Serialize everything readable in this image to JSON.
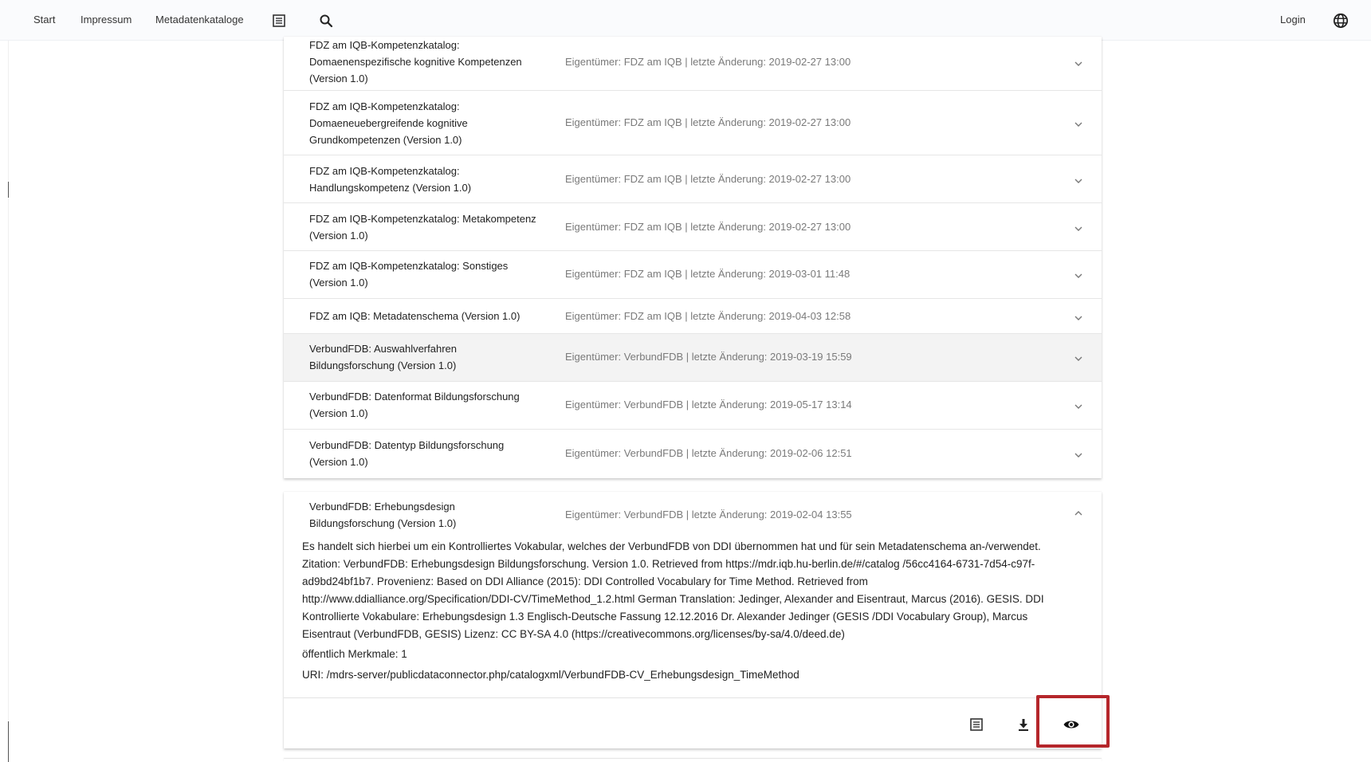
{
  "nav": {
    "start": "Start",
    "impressum": "Impressum",
    "metadatenkataloge": "Metadatenkataloge",
    "login": "Login",
    "icons": [
      "list-icon",
      "search-icon",
      "globe-icon"
    ]
  },
  "catalogs": [
    {
      "title": "FDZ am IQB-Kompetenzkatalog: Domaenenspezifische kognitive Kompetenzen (Version 1.0)",
      "meta": "Eigentümer: FDZ am IQB | letzte Änderung: 2019-02-27 13:00"
    },
    {
      "title": "FDZ am IQB-Kompetenzkatalog: Domaeneuebergreifende kognitive Grundkompetenzen (Version 1.0)",
      "meta": "Eigentümer: FDZ am IQB | letzte Änderung: 2019-02-27 13:00"
    },
    {
      "title": "FDZ am IQB-Kompetenzkatalog: Handlungskompetenz (Version 1.0)",
      "meta": "Eigentümer: FDZ am IQB | letzte Änderung: 2019-02-27 13:00"
    },
    {
      "title": "FDZ am IQB-Kompetenzkatalog: Metakompetenz (Version 1.0)",
      "meta": "Eigentümer: FDZ am IQB | letzte Änderung: 2019-02-27 13:00"
    },
    {
      "title": "FDZ am IQB-Kompetenzkatalog: Sonstiges (Version 1.0)",
      "meta": "Eigentümer: FDZ am IQB | letzte Änderung: 2019-03-01 11:48"
    },
    {
      "title": "FDZ am IQB: Metadatenschema (Version 1.0)",
      "meta": "Eigentümer: FDZ am IQB | letzte Änderung: 2019-04-03 12:58"
    },
    {
      "title": "VerbundFDB: Auswahlverfahren Bildungsforschung (Version 1.0)",
      "meta": "Eigentümer: VerbundFDB | letzte Änderung: 2019-03-19 15:59"
    },
    {
      "title": "VerbundFDB: Datenformat Bildungsforschung (Version 1.0)",
      "meta": "Eigentümer: VerbundFDB | letzte Änderung: 2019-05-17 13:14"
    },
    {
      "title": "VerbundFDB: Datentyp Bildungsforschung (Version 1.0)",
      "meta": "Eigentümer: VerbundFDB | letzte Änderung: 2019-02-06 12:51"
    }
  ],
  "expanded": {
    "title": "VerbundFDB: Erhebungsdesign Bildungsforschung (Version 1.0)",
    "meta": "Eigentümer: VerbundFDB | letzte Änderung: 2019-02-04 13:55",
    "description": "Es handelt sich hierbei um ein Kontrolliertes Vokabular, welches der VerbundFDB von DDI übernommen hat und für sein Metadatenschema an-/verwendet. Zitation: VerbundFDB: Erhebungsdesign Bildungsforschung. Version 1.0. Retrieved from https://mdr.iqb.hu-berlin.de/#/catalog /56cc4164-6731-7d54-c97f-ad9bd24bf1b7. Provenienz: Based on DDI Alliance (2015): DDI Controlled Vocabulary for Time Method. Retrieved from http://www.ddialliance.org/Specification/DDI-CV/TimeMethod_1.2.html German Translation: Jedinger, Alexander and Eisentraut, Marcus (2016). GESIS. DDI Kontrollierte Vokabulare: Erhebungsdesign 1.3 Englisch-Deutsche Fassung 12.12.2016 Dr. Alexander Jedinger (GESIS /DDI Vocabulary Group), Marcus Eisentraut (VerbundFDB, GESIS) Lizenz: CC BY-SA 4.0 (https://creativecommons.org/licenses/by-sa/4.0/deed.de)",
    "counts": "öffentlich Merkmale: 1",
    "uri": "URI: /mdrs-server/publicdataconnector.php/catalogxml/VerbundFDB-CV_Erhebungsdesign_TimeMethod",
    "actions": [
      "list-icon",
      "download-icon",
      "eye-icon"
    ]
  },
  "colors": {
    "highlight": "#b5262b",
    "hover_row": "#f3f3f3",
    "meta_text": "#7a7a7a"
  }
}
